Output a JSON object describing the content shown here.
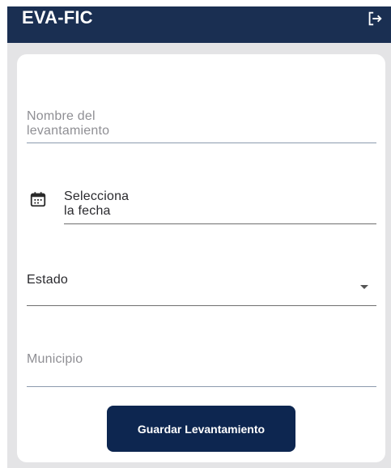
{
  "appbar": {
    "title": "EVA-FIC",
    "logout_icon": "logout-icon",
    "background_color": "#1a2f52"
  },
  "form": {
    "nombre": {
      "placeholder": "Nombre del levantamiento",
      "value": ""
    },
    "fecha": {
      "placeholder": "Selecciona la fecha",
      "icon": "calendar-icon"
    },
    "estado": {
      "label": "Estado",
      "icon": "dropdown-arrow-icon"
    },
    "municipio": {
      "placeholder": "Municipio",
      "value": ""
    },
    "save_label": "Guardar Levantamiento"
  },
  "colors": {
    "accent": "#0d2650",
    "card_background": "#ffffff",
    "panel_background": "#e4e4e6"
  }
}
